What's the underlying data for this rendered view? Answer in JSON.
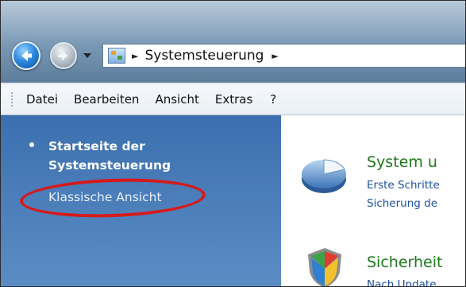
{
  "addressbar": {
    "path_label": "Systemsteuerung",
    "sep_glyph": "►"
  },
  "menu": {
    "items": [
      "Datei",
      "Bearbeiten",
      "Ansicht",
      "Extras",
      "?"
    ]
  },
  "sidebar": {
    "home_line1": "Startseite der",
    "home_line2": "Systemsteuerung",
    "classic_view": "Klassische Ansicht",
    "annotation_color": "#d61a1a"
  },
  "categories": [
    {
      "title": "System u",
      "links": [
        "Erste Schritte",
        "Sicherung de"
      ],
      "icon": "system-pie-icon"
    },
    {
      "title": "Sicherheit",
      "links": [
        "Nach Update"
      ],
      "icon": "security-shield-icon"
    }
  ]
}
